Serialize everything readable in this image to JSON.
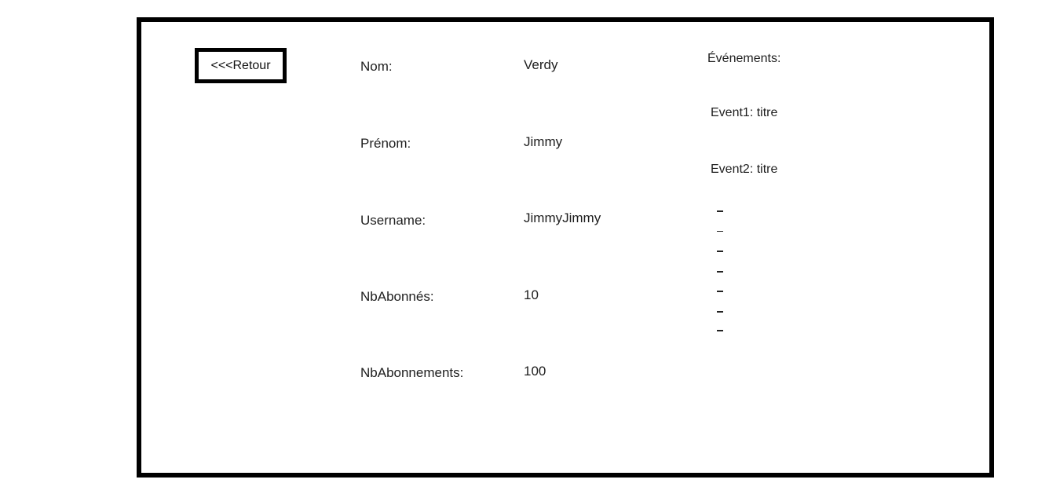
{
  "back_button": {
    "label": "<<<Retour"
  },
  "profile": {
    "fields": [
      {
        "label": "Nom:",
        "value": "Verdy"
      },
      {
        "label": "Prénom:",
        "value": "Jimmy"
      },
      {
        "label": "Username:",
        "value": "JimmyJimmy"
      },
      {
        "label": "NbAbonnés:",
        "value": "10"
      },
      {
        "label": "NbAbonnements:",
        "value": "100"
      }
    ]
  },
  "events": {
    "title": "Événements:",
    "items": [
      "Event1: titre",
      "Event2: titre"
    ],
    "placeholder_count": 7
  }
}
